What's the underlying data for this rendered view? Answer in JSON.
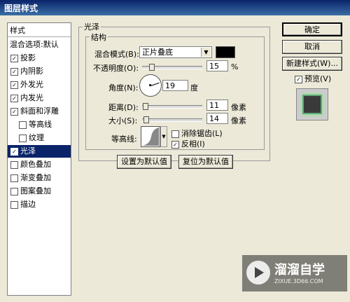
{
  "window": {
    "title": "图层样式"
  },
  "left_panel": {
    "header": "样式",
    "items": [
      {
        "label": "混合选项:默认",
        "check": ""
      },
      {
        "label": "投影",
        "check": "✓"
      },
      {
        "label": "内阴影",
        "check": "✓"
      },
      {
        "label": "外发光",
        "check": "✓"
      },
      {
        "label": "内发光",
        "check": "✓"
      },
      {
        "label": "斜面和浮雕",
        "check": "✓"
      },
      {
        "label": "等高线",
        "check": ""
      },
      {
        "label": "纹理",
        "check": ""
      },
      {
        "label": "光泽",
        "check": "✓"
      },
      {
        "label": "颜色叠加",
        "check": ""
      },
      {
        "label": "渐变叠加",
        "check": ""
      },
      {
        "label": "图案叠加",
        "check": ""
      },
      {
        "label": "描边",
        "check": ""
      }
    ]
  },
  "satin": {
    "title": "光泽",
    "structure_title": "结构",
    "blend_mode_label": "混合模式(B):",
    "blend_mode_value": "正片叠底",
    "opacity_label": "不透明度(O):",
    "opacity_value": "15",
    "opacity_unit": "%",
    "opacity_level": 0.15,
    "angle_label": "角度(N):",
    "angle_value": "19",
    "angle_unit": "度",
    "distance_label": "距离(D):",
    "distance_value": "11",
    "distance_unit": "像素",
    "distance_level": 0.05,
    "size_label": "大小(S):",
    "size_value": "14",
    "size_unit": "像素",
    "size_level": 0.06,
    "contour_label": "等高线:",
    "antialias_label": "消除锯齿(L)",
    "antialias_check": "",
    "invert_label": "反相(I)",
    "invert_check": "✓",
    "color_swatch": "#000000"
  },
  "buttons": {
    "make_default": "设置为默认值",
    "reset_default": "复位为默认值",
    "ok": "确定",
    "cancel": "取消",
    "new_style": "新建样式(W)...",
    "preview_label": "预览(V)",
    "preview_check": "✓"
  },
  "watermark": {
    "name": "溜溜自学",
    "url": "ZIXUE.3D66.COM"
  }
}
